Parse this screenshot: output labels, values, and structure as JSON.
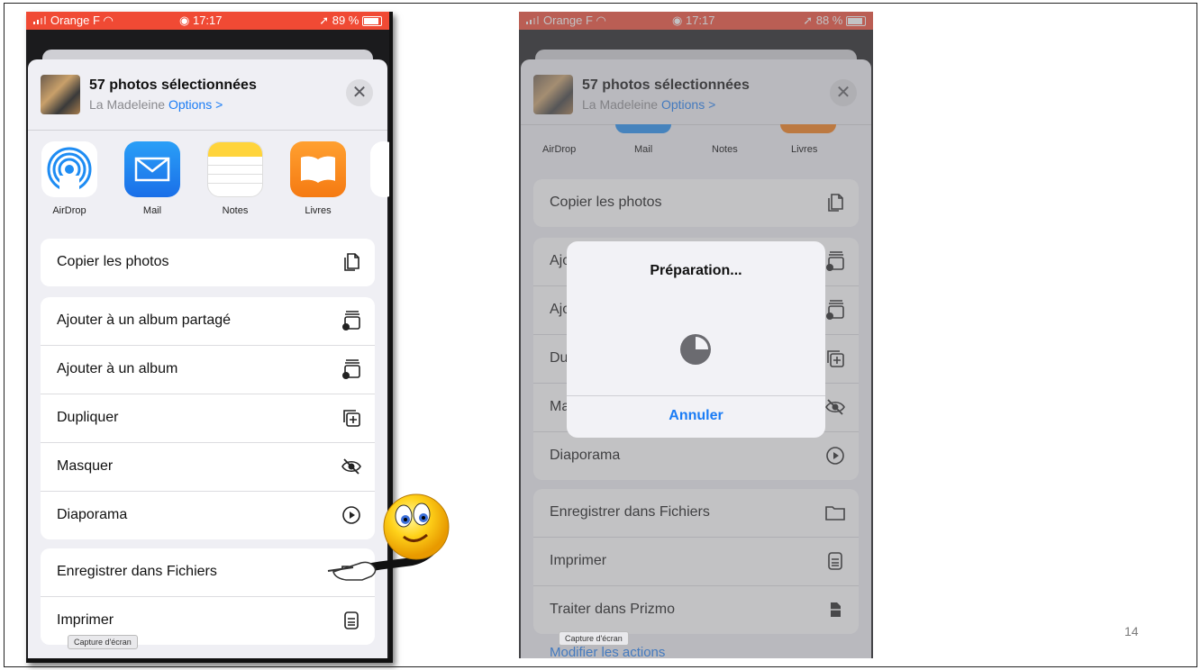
{
  "left_phone": {
    "status": {
      "carrier": "Orange F",
      "time": "17:17",
      "battery": "89 %"
    },
    "header": {
      "title": "57 photos sélectionnées",
      "location": "La Madeleine",
      "options": "Options >",
      "close": "✕"
    },
    "apps": [
      {
        "label": "AirDrop",
        "icon": "airdrop-icon"
      },
      {
        "label": "Mail",
        "icon": "mail-icon"
      },
      {
        "label": "Notes",
        "icon": "notes-icon"
      },
      {
        "label": "Livres",
        "icon": "books-icon"
      }
    ],
    "copy_row": {
      "label": "Copier les photos"
    },
    "actions": [
      {
        "label": "Ajouter à un album partagé",
        "icon": "shared-album-icon"
      },
      {
        "label": "Ajouter à un album",
        "icon": "add-album-icon"
      },
      {
        "label": "Dupliquer",
        "icon": "duplicate-icon"
      },
      {
        "label": "Masquer",
        "icon": "hide-eye-icon"
      },
      {
        "label": "Diaporama",
        "icon": "play-icon"
      }
    ],
    "file_actions": [
      {
        "label": "Enregistrer dans Fichiers",
        "icon": "folder-icon"
      },
      {
        "label": "Imprimer",
        "icon": "printer-icon"
      }
    ],
    "tooltip": "Capture d'écran"
  },
  "right_phone": {
    "status": {
      "carrier": "Orange F",
      "time": "17:17",
      "battery": "88 %"
    },
    "header": {
      "title": "57 photos sélectionnées",
      "location": "La Madeleine",
      "options": "Options >",
      "close": "✕"
    },
    "apps": [
      {
        "label": "AirDrop"
      },
      {
        "label": "Mail"
      },
      {
        "label": "Notes"
      },
      {
        "label": "Livres"
      }
    ],
    "copy_row": {
      "label": "Copier les photos"
    },
    "partial_rows": [
      "Ajo",
      "Ajo",
      "Du",
      "Ma"
    ],
    "diaporama": "Diaporama",
    "file_actions": [
      {
        "label": "Enregistrer dans Fichiers",
        "icon": "folder-icon"
      },
      {
        "label": "Imprimer",
        "icon": "printer-icon"
      },
      {
        "label": "Traiter dans Prizmo",
        "icon": "document-icon"
      }
    ],
    "footer_link": "Modifier les actions",
    "alert": {
      "title": "Préparation...",
      "cancel": "Annuler"
    },
    "tooltip": "Capture d'écran"
  },
  "page_number": "14"
}
